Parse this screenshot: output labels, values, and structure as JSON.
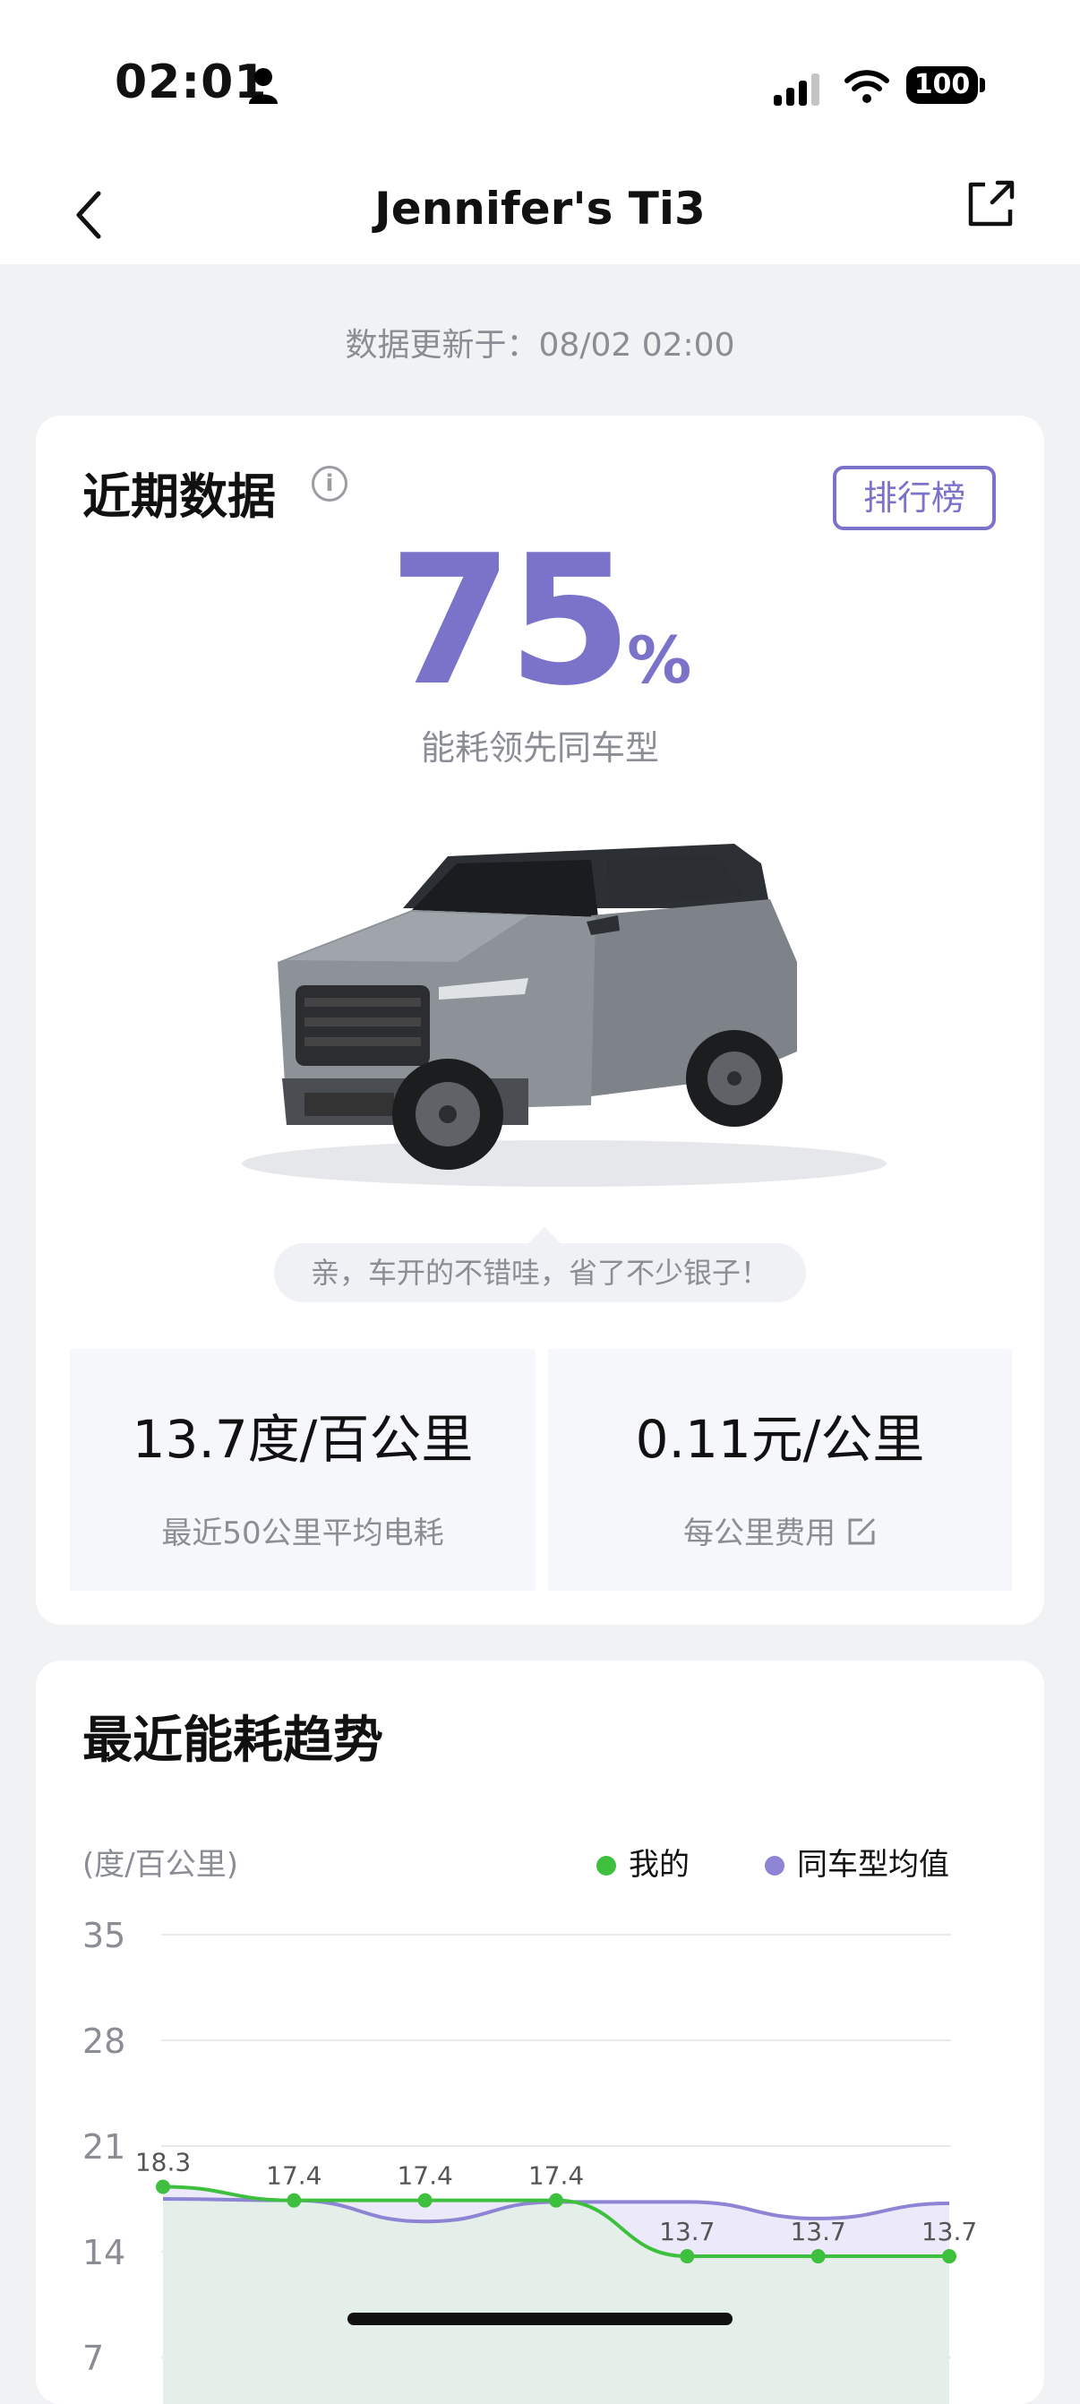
{
  "status_bar": {
    "time": "02:01",
    "battery": "100",
    "icons": [
      "person-icon",
      "signal-icon",
      "wifi-icon",
      "battery-icon"
    ]
  },
  "nav": {
    "title": "Jennifer's Ti3",
    "icons": [
      "chevron-left-icon",
      "share-icon"
    ]
  },
  "updated_text": "数据更新于：08/02 02:00",
  "recent": {
    "title": "近期数据",
    "info_icon_glyph": "i",
    "rank_button": "排行榜",
    "percent": "75",
    "percent_unit": "%",
    "percent_label": "能耗领先同车型",
    "bubble": "亲，车开的不错哇，省了不少银子！",
    "stats": [
      {
        "value": "13.7度/百公里",
        "label": "最近50公里平均电耗"
      },
      {
        "value": "0.11元/公里",
        "label": "每公里费用"
      }
    ]
  },
  "trend": {
    "title": "最近能耗趋势",
    "unit": "(度/百公里)",
    "legend_mine": "我的",
    "legend_avg": "同车型均值"
  },
  "colors": {
    "accent": "#7b72c9",
    "mine": "#3ec03e",
    "avg": "#8d84d4",
    "muted": "#8a8d93"
  },
  "chart_data": {
    "type": "line",
    "ylabel": "(度/百公里)",
    "yticks": [
      35,
      28,
      21,
      14,
      7
    ],
    "ylim": [
      7,
      35
    ],
    "x": [
      1,
      2,
      3,
      4,
      5,
      6,
      7
    ],
    "series": [
      {
        "name": "我的",
        "values": [
          18.3,
          17.4,
          17.4,
          17.4,
          13.7,
          13.7,
          13.7
        ],
        "labels": [
          "18.3",
          "17.4",
          "17.4",
          "17.4",
          "13.7",
          "13.7",
          "13.7"
        ]
      },
      {
        "name": "同车型均值",
        "values": [
          17.5,
          17.4,
          16.0,
          17.3,
          17.3,
          16.2,
          17.2
        ]
      }
    ],
    "grid": true,
    "legend": "top-right"
  }
}
